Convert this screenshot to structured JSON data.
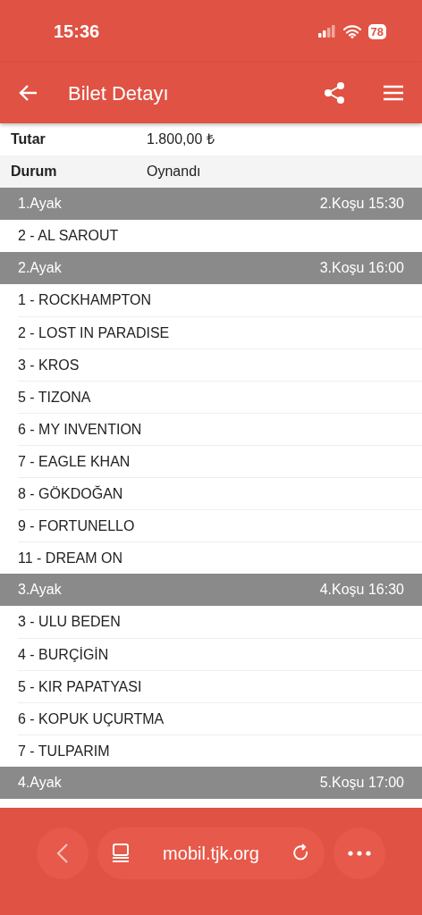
{
  "status_bar": {
    "time": "15:36",
    "battery": "78"
  },
  "app_bar": {
    "title": "Bilet Detayı"
  },
  "summary": [
    {
      "label": "Tutar",
      "value": "1.800,00 ₺"
    },
    {
      "label": "Durum",
      "value": "Oynandı"
    }
  ],
  "legs": [
    {
      "title": "1.Ayak",
      "race": "2.Koşu 15:30",
      "runners": [
        "2 - AL SAROUT"
      ]
    },
    {
      "title": "2.Ayak",
      "race": "3.Koşu 16:00",
      "runners": [
        "1 - ROCKHAMPTON",
        "2 - LOST IN PARADISE",
        "3 - KROS",
        "5 - TIZONA",
        "6 - MY INVENTION",
        "7 - EAGLE KHAN",
        "8 - GÖKDOĞAN",
        "9 - FORTUNELLO",
        "11 - DREAM ON"
      ]
    },
    {
      "title": "3.Ayak",
      "race": "4.Koşu 16:30",
      "runners": [
        "3 - ULU BEDEN",
        "4 - BURÇİGİN",
        "5 - KIR PAPATYASI",
        "6 - KOPUK UÇURTMA",
        "7 - TULPARIM"
      ]
    },
    {
      "title": "4.Ayak",
      "race": "5.Koşu 17:00"
    }
  ],
  "browser_bar": {
    "address": "mobil.tjk.org"
  }
}
